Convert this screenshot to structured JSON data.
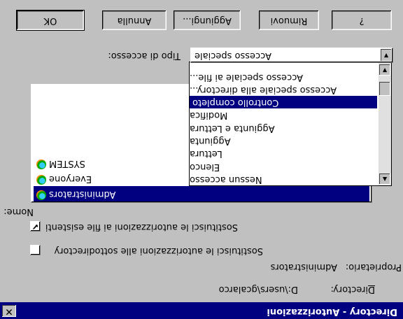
{
  "window": {
    "title": "Directory - Autorizzazioni"
  },
  "directory": {
    "label": "Directory:",
    "value": "D:\\users\\gcalarco"
  },
  "owner": {
    "label": "Proprietario:",
    "value": "Administrators"
  },
  "options": {
    "replace_subdirs": {
      "label": "Sostituisci le autorizzazioni alle sottodirectory",
      "checked": false
    },
    "replace_files": {
      "label": "Sostituisci le autorizzazioni ai file esistenti",
      "checked": true,
      "check_glyph": "✔"
    }
  },
  "names": {
    "label": "Nome:",
    "items": [
      {
        "name": "Administrators",
        "selected": true
      },
      {
        "name": "Everyone",
        "selected": false
      },
      {
        "name": "SYSTEM",
        "selected": false
      }
    ]
  },
  "access_type": {
    "label": "Tipo di accesso:",
    "value": "Accesso speciale",
    "options": [
      {
        "label": "Nessun accesso",
        "selected": false
      },
      {
        "label": "Elenco",
        "selected": false
      },
      {
        "label": "Lettura",
        "selected": false
      },
      {
        "label": "Aggiunta",
        "selected": false
      },
      {
        "label": "Aggiunta e Lettura",
        "selected": false
      },
      {
        "label": "Modifica",
        "selected": false
      },
      {
        "label": "Controllo completo",
        "selected": true
      },
      {
        "label": "Accesso speciale alla directory...",
        "selected": false
      },
      {
        "label": "Accesso speciale ai file...",
        "selected": false
      }
    ]
  },
  "buttons": {
    "ok": "OK",
    "cancel": "Annulla",
    "add": "Aggiungi...",
    "remove": "Rimuovi",
    "help": "?"
  },
  "glyphs": {
    "close": "✕",
    "arrow_down": "▼",
    "arrow_up": "▲"
  }
}
